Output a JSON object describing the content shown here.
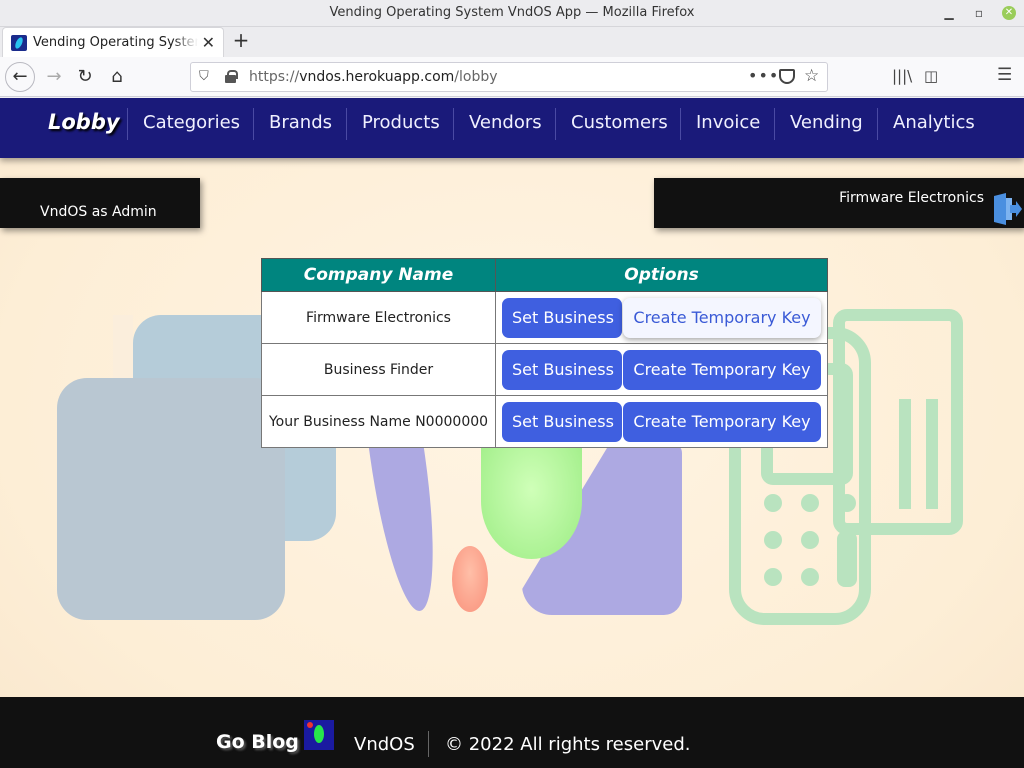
{
  "window": {
    "title": "Vending Operating System VndOS App — Mozilla Firefox"
  },
  "browser": {
    "tab_title": "Vending Operating System VndOS App",
    "url_prefix": "https://",
    "url_host": "vndos.herokuapp.com",
    "url_path": "/lobby"
  },
  "nav": {
    "brand": "Lobby",
    "items": [
      "Categories",
      "Brands",
      "Products",
      "Vendors",
      "Customers",
      "Invoice",
      "Vending",
      "Analytics"
    ]
  },
  "user_panel": {
    "label": "VndOS as Admin"
  },
  "business_panel": {
    "name": "Firmware Electronics"
  },
  "table": {
    "headers": [
      "Company Name",
      "Options"
    ],
    "rows": [
      {
        "company": "Firmware Electronics",
        "set_label": "Set Business",
        "key_label": "Create Temporary Key"
      },
      {
        "company": "Business Finder",
        "set_label": "Set Business",
        "key_label": "Create Temporary Key"
      },
      {
        "company": "Your Business Name N0000000",
        "set_label": "Set Business",
        "key_label": "Create Temporary Key"
      }
    ]
  },
  "footer": {
    "blog": "Go Blog",
    "app": "VndOS",
    "copyright": "© 2022 All rights reserved."
  },
  "colors": {
    "nav_bg": "#1a1a7a",
    "table_header": "#00857f",
    "button": "#3f5fe0",
    "panel_bg": "#111111"
  }
}
